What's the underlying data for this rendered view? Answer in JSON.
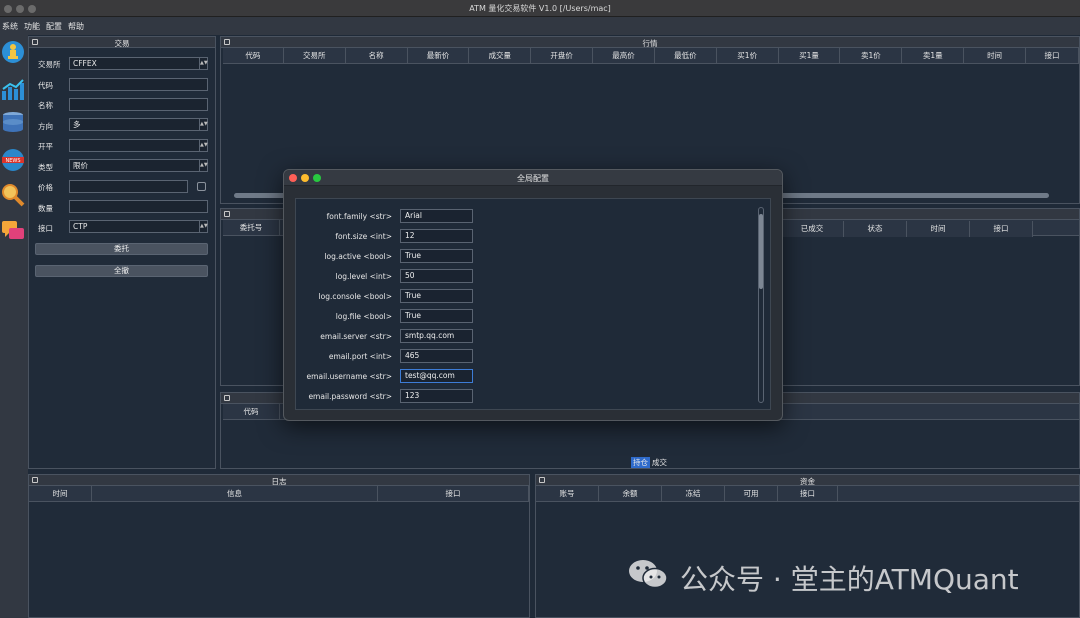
{
  "window": {
    "title": "ATM 量化交易软件 V1.0  [/Users/mac]"
  },
  "menu": [
    "系统",
    "功能",
    "配置",
    "帮助"
  ],
  "sidebar_icons": [
    "chess-pawn-icon",
    "bar-chart-icon",
    "database-icon",
    "news-globe-icon",
    "search-icon",
    "chat-icon"
  ],
  "trade": {
    "title": "交易",
    "fields": [
      {
        "label": "交易所",
        "value": "CFFEX",
        "dropdown": true
      },
      {
        "label": "代码",
        "value": "",
        "dropdown": false
      },
      {
        "label": "名称",
        "value": "",
        "dropdown": false
      },
      {
        "label": "方向",
        "value": "多",
        "dropdown": true
      },
      {
        "label": "开平",
        "value": "",
        "dropdown": true
      },
      {
        "label": "类型",
        "value": "限价",
        "dropdown": true
      },
      {
        "label": "价格",
        "value": "",
        "dropdown": false
      },
      {
        "label": "数量",
        "value": "",
        "dropdown": false
      },
      {
        "label": "接口",
        "value": "CTP",
        "dropdown": true
      }
    ],
    "send_button": "委托",
    "cancel_all_button": "全撤"
  },
  "market": {
    "title": "行情",
    "columns": [
      "代码",
      "交易所",
      "名称",
      "最新价",
      "成交量",
      "开盘价",
      "最高价",
      "最低价",
      "买1价",
      "买1量",
      "卖1价",
      "卖1量",
      "时间",
      "接口"
    ]
  },
  "orders": {
    "columns_left": [
      "委托号"
    ],
    "columns_right": [
      "已成交",
      "状态",
      "时间",
      "接口"
    ]
  },
  "positions": {
    "columns": [
      "代码"
    ],
    "tabs": [
      "持仓",
      "成交"
    ]
  },
  "log": {
    "title": "日志",
    "columns": [
      "时间",
      "信息",
      "接口"
    ]
  },
  "account": {
    "title": "资金",
    "columns": [
      "账号",
      "余额",
      "冻结",
      "可用",
      "接口"
    ]
  },
  "dialog": {
    "title": "全局配置",
    "items": [
      {
        "key": "font.family <str>",
        "value": "Arial"
      },
      {
        "key": "font.size <int>",
        "value": "12"
      },
      {
        "key": "log.active <bool>",
        "value": "True"
      },
      {
        "key": "log.level <int>",
        "value": "50"
      },
      {
        "key": "log.console <bool>",
        "value": "True"
      },
      {
        "key": "log.file <bool>",
        "value": "True"
      },
      {
        "key": "email.server <str>",
        "value": "smtp.qq.com"
      },
      {
        "key": "email.port <int>",
        "value": "465"
      },
      {
        "key": "email.username <str>",
        "value": "test@qq.com"
      },
      {
        "key": "email.password <str>",
        "value": "123"
      }
    ]
  },
  "watermark": "公众号 · 堂主的ATMQuant"
}
